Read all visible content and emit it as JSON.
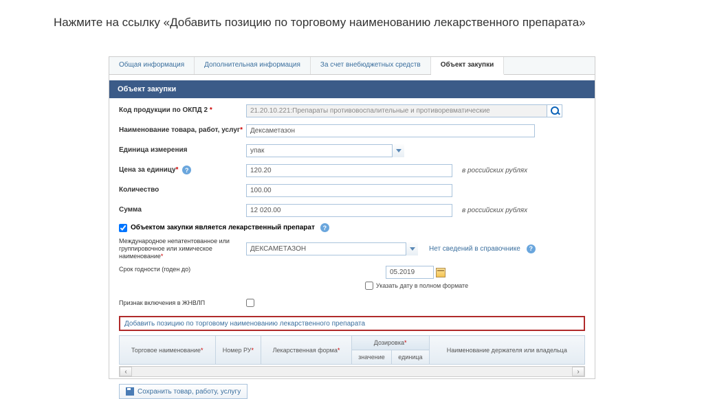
{
  "instruction": "Нажмите на ссылку «Добавить позицию по торговому наименованию лекарственного препарата»",
  "tabs": [
    "Общая информация",
    "Дополнительная информация",
    "За счет внебюджетных средств",
    "Объект закупки"
  ],
  "section": {
    "title": "Объект закупки"
  },
  "form": {
    "okpd": {
      "label": "Код продукции по ОКПД 2",
      "value": "21.20.10.221:Препараты противовоспалительные и противоревматические"
    },
    "name": {
      "label": "Наименование товара, работ, услуг",
      "value": "Дексаметазон"
    },
    "unit": {
      "label": "Единица измерения",
      "value": "упак"
    },
    "price": {
      "label": "Цена за единицу",
      "value": "120.20",
      "suffix": "в российских рублях"
    },
    "qty": {
      "label": "Количество",
      "value": "100.00"
    },
    "sum": {
      "label": "Сумма",
      "value": "12 020.00",
      "suffix": "в российских рублях"
    },
    "is_drug": {
      "label": "Объектом закупки является лекарственный препарат"
    },
    "mnn": {
      "label": "Международное непатентованное или группировочное или химическое наименование",
      "value": "ДЕКСАМЕТАЗОН",
      "no_ref": "Нет сведений в справочнике"
    },
    "expiry": {
      "label": "Срок годности (годен до)",
      "value": "05.2019",
      "full_format": "Указать дату в полном формате"
    },
    "zhnvlp": {
      "label": "Признак включения в ЖНВЛП"
    },
    "add_position_link": "Добавить позицию по торговому наименованию лекарственного препарата"
  },
  "table": {
    "cols": [
      "Торговое наименование",
      "Номер РУ",
      "Лекарственная форма",
      "Дозировка",
      "Наименование держателя или владельца"
    ],
    "sub": [
      "значение",
      "единица"
    ]
  },
  "buttons": {
    "save": "Сохранить товар, работу, услугу"
  }
}
